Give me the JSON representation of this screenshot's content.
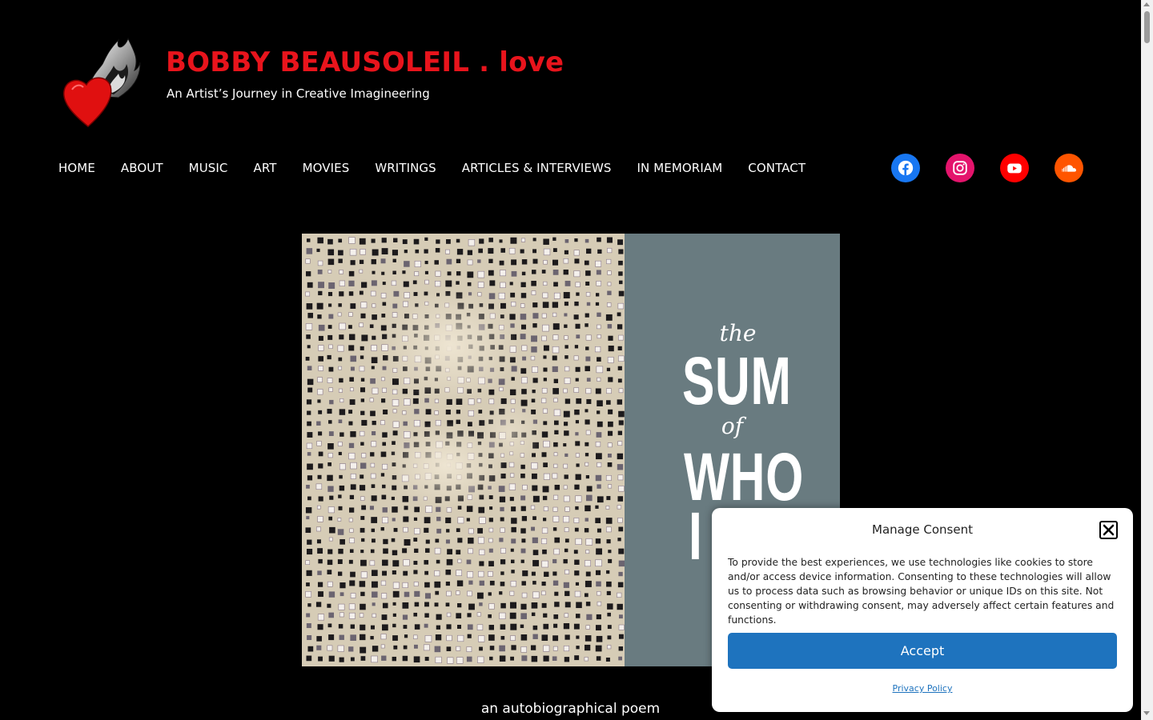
{
  "site": {
    "title": "BOBBY BEAUSOLEIL . love",
    "tagline": "An Artist’s Journey in Creative Imagineering",
    "logo_icon": "flaming-heart-icon"
  },
  "nav": {
    "items": [
      {
        "label": "HOME"
      },
      {
        "label": "ABOUT"
      },
      {
        "label": "MUSIC"
      },
      {
        "label": "ART"
      },
      {
        "label": "MOVIES"
      },
      {
        "label": "WRITINGS"
      },
      {
        "label": "ARTICLES & INTERVIEWS"
      },
      {
        "label": "IN MEMORIAM"
      },
      {
        "label": "CONTACT"
      }
    ]
  },
  "social": [
    {
      "icon": "facebook-icon",
      "color": "#1877f2"
    },
    {
      "icon": "instagram-icon",
      "color": "#e4146c"
    },
    {
      "icon": "youtube-icon",
      "color": "#ff0000"
    },
    {
      "icon": "soundcloud-icon",
      "color": "#ff5500"
    }
  ],
  "hero": {
    "book_title_the": "the",
    "book_title_sum": "SUM",
    "book_title_of": "of",
    "book_title_who": "WHO",
    "book_title_i": "I",
    "caption": "an autobiographical poem"
  },
  "consent": {
    "title": "Manage Consent",
    "body": "To provide the best experiences, we use technologies like cookies to store and/or access device information. Consenting to these technologies will allow us to process data such as browsing behavior or unique IDs on this site. Not consenting or withdrawing consent, may adversely affect certain features and functions.",
    "accept_label": "Accept",
    "privacy_label": "Privacy Policy",
    "accent_color": "#1e73be"
  },
  "colors": {
    "background": "#000000",
    "title": "#e8141c",
    "panel": "#697b80"
  }
}
